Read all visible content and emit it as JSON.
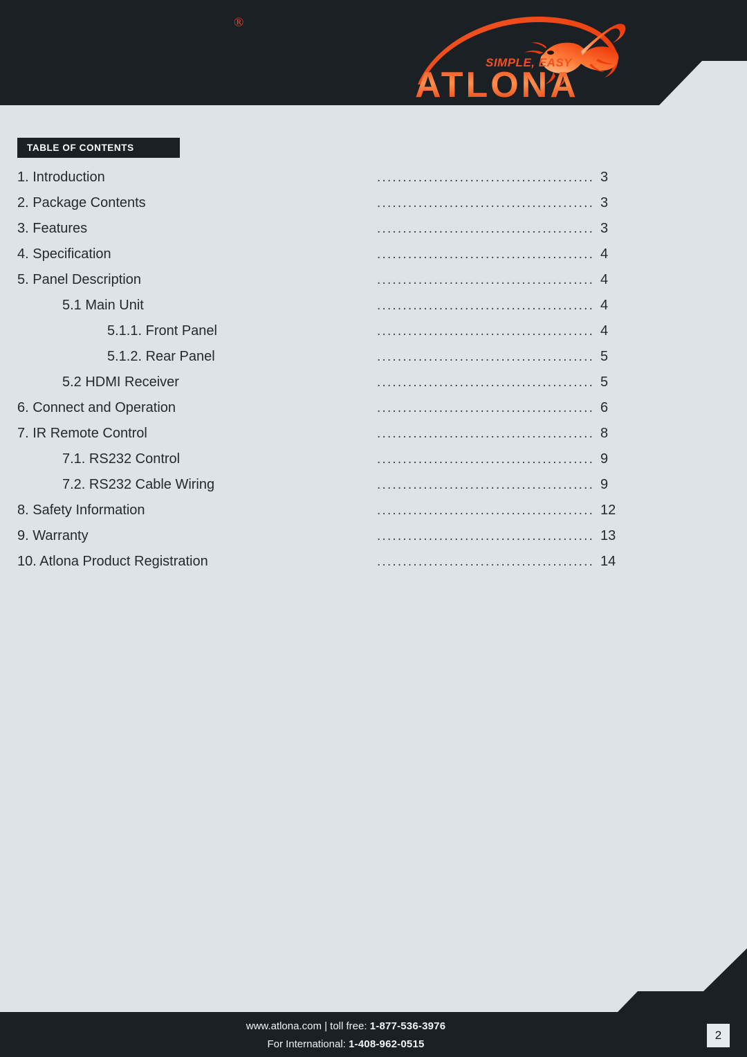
{
  "brand": {
    "name": "ATLONA",
    "tagline": "SIMPLE, EASY",
    "registered_mark": "®",
    "logo_color": "#f04a1e",
    "logo_color_light": "#ff8a4a"
  },
  "header": {
    "background": "#1b2025"
  },
  "page": {
    "background": "#dde3e7",
    "number": "2"
  },
  "toc": {
    "heading": "TABLE OF CONTENTS",
    "dots": "...........................................",
    "entries": [
      {
        "label": "1. Introduction",
        "page": "3",
        "level": 1
      },
      {
        "label": "2. Package Contents",
        "page": "3",
        "level": 1
      },
      {
        "label": "3. Features",
        "page": "3",
        "level": 1
      },
      {
        "label": "4. Specification",
        "page": "4",
        "level": 1
      },
      {
        "label": "5. Panel Description",
        "page": "4",
        "level": 1
      },
      {
        "label": "5.1 Main Unit",
        "page": "4",
        "level": 2
      },
      {
        "label": "5.1.1. Front Panel",
        "page": "4",
        "level": 3
      },
      {
        "label": "5.1.2. Rear Panel",
        "page": "5",
        "level": 3
      },
      {
        "label": "5.2 HDMI Receiver",
        "page": "5",
        "level": 2
      },
      {
        "label": "6. Connect and Operation",
        "page": "6",
        "level": 1
      },
      {
        "label": "7. IR Remote Control",
        "page": "8",
        "level": 1
      },
      {
        "label": "7.1. RS232 Control",
        "page": "9",
        "level": 2
      },
      {
        "label": "7.2. RS232 Cable Wiring",
        "page": "9",
        "level": 2
      },
      {
        "label": "8. Safety Information",
        "page": "12",
        "level": 1
      },
      {
        "label": "9. Warranty",
        "page": "13",
        "level": 1
      },
      {
        "label": "10. Atlona Product Registration",
        "page": "14",
        "level": 1
      }
    ]
  },
  "footer": {
    "line1_prefix": "www.atlona.com | toll free: ",
    "line1_number": "1-877-536-3976",
    "line2_prefix": "For International: ",
    "line2_number": "1-408-962-0515",
    "page_number": "2"
  }
}
